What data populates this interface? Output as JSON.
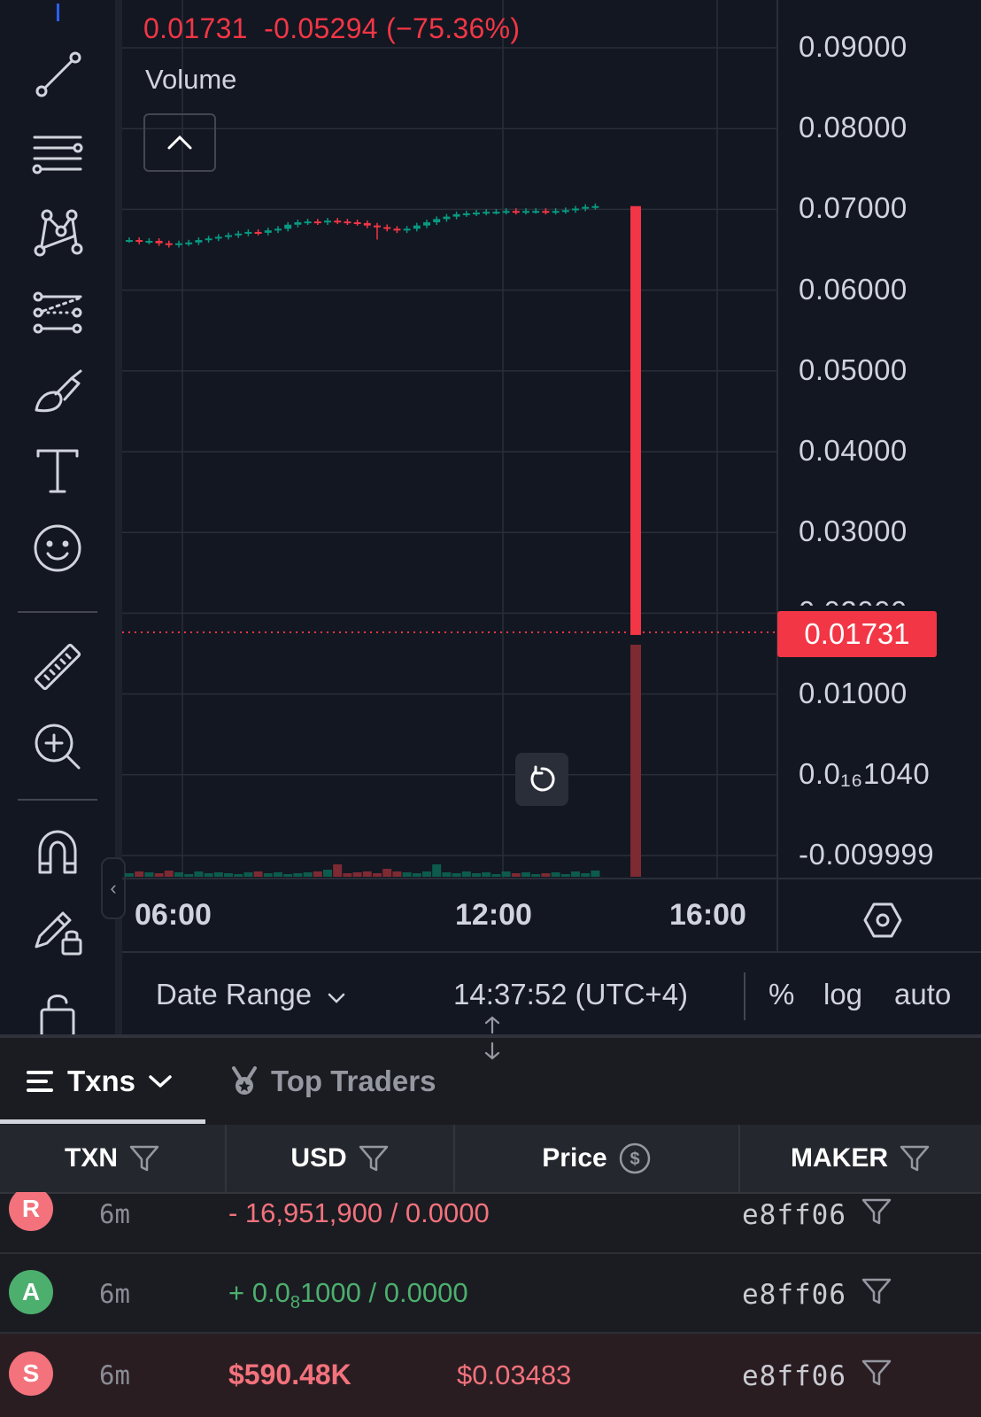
{
  "chart": {
    "legend": {
      "price": "0.01731",
      "change": "-0.05294",
      "change_pct": "(−75.36%)",
      "volume_label": "Volume"
    },
    "current_price_tag": "0.01731",
    "colors": {
      "up": "#089981",
      "down": "#f23645",
      "background": "#131722",
      "grid": "#2a2e39"
    }
  },
  "chart_data": {
    "type": "candlestick",
    "y_ticks": [
      "0.09000",
      "0.08000",
      "0.07000",
      "0.06000",
      "0.05000",
      "0.04000",
      "0.03000",
      "0.02000",
      "0.01000",
      "0.0₁₆1040",
      "-0.009999"
    ],
    "x_ticks": [
      "06:00",
      "12:00",
      "16:00"
    ],
    "ylim": [
      -0.01,
      0.095
    ],
    "grid": true,
    "last_price": 0.01731,
    "candles_summary": "price drifts from ~0.066 to ~0.070 between 05:00 and 14:00, then a single candle drops from ~0.0705 to 0.01731"
  },
  "toolbar": {
    "tools": [
      "trendline-icon",
      "fib-icon",
      "pattern-icon",
      "projection-icon",
      "brush-icon",
      "text-icon",
      "emoji-icon",
      "ruler-icon",
      "zoom-in-icon",
      "magnet-icon",
      "lock-drawings-icon",
      "lock-icon"
    ]
  },
  "bottom_bar": {
    "date_range": "Date Range",
    "clock": "14:37:52 (UTC+4)",
    "pct": "%",
    "log": "log",
    "auto": "auto"
  },
  "tabs": {
    "txns": "Txns",
    "top_traders": "Top Traders"
  },
  "table": {
    "headers": [
      "TXN",
      "USD",
      "Price",
      "MAKER"
    ],
    "rows": [
      {
        "avatar": "R",
        "avatar_color": "#f3727c",
        "age": "6m",
        "amount": "- 16,951,900  /  0.0000",
        "maker": "e8ff06"
      },
      {
        "avatar": "A",
        "avatar_color": "#4caf6e",
        "age": "6m",
        "amount_prefix": "+ 0.0",
        "amount_sub": "8",
        "amount_rest": "1000  /  0.0000",
        "maker": "e8ff06"
      },
      {
        "avatar": "S",
        "avatar_color": "#f3727c",
        "age": "6m",
        "usd": "$590.48K",
        "price": "$0.03483",
        "maker": "e8ff06"
      }
    ]
  }
}
